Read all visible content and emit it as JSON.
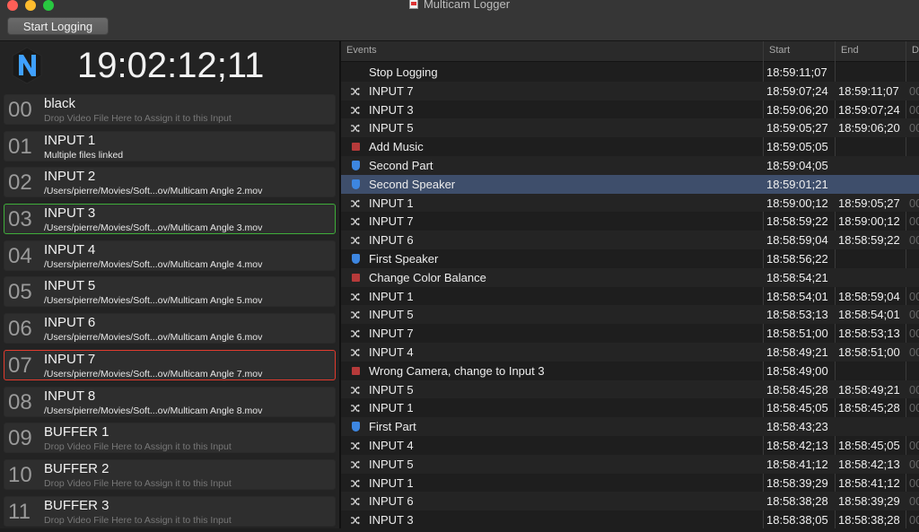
{
  "window": {
    "title": "Multicam Logger"
  },
  "toolbar": {
    "start_label": "Start Logging"
  },
  "timecode": "19:02:12;11",
  "inputs": [
    {
      "num": "00",
      "name": "black",
      "sub": "Drop Video File Here to Assign it to this Input",
      "dim": true,
      "state": ""
    },
    {
      "num": "01",
      "name": "INPUT 1",
      "sub": "Multiple files linked",
      "dim": false,
      "state": ""
    },
    {
      "num": "02",
      "name": "INPUT 2",
      "sub": "/Users/pierre/Movies/Soft...ov/Multicam Angle 2.mov",
      "dim": false,
      "state": ""
    },
    {
      "num": "03",
      "name": "INPUT 3",
      "sub": "/Users/pierre/Movies/Soft...ov/Multicam Angle 3.mov",
      "dim": false,
      "state": "green"
    },
    {
      "num": "04",
      "name": "INPUT 4",
      "sub": "/Users/pierre/Movies/Soft...ov/Multicam Angle 4.mov",
      "dim": false,
      "state": ""
    },
    {
      "num": "05",
      "name": "INPUT 5",
      "sub": "/Users/pierre/Movies/Soft...ov/Multicam Angle 5.mov",
      "dim": false,
      "state": ""
    },
    {
      "num": "06",
      "name": "INPUT 6",
      "sub": "/Users/pierre/Movies/Soft...ov/Multicam Angle 6.mov",
      "dim": false,
      "state": ""
    },
    {
      "num": "07",
      "name": "INPUT 7",
      "sub": "/Users/pierre/Movies/Soft...ov/Multicam Angle 7.mov",
      "dim": false,
      "state": "red"
    },
    {
      "num": "08",
      "name": "INPUT 8",
      "sub": "/Users/pierre/Movies/Soft...ov/Multicam Angle 8.mov",
      "dim": false,
      "state": ""
    },
    {
      "num": "09",
      "name": "BUFFER 1",
      "sub": "Drop Video File Here to Assign it to this Input",
      "dim": true,
      "state": ""
    },
    {
      "num": "10",
      "name": "BUFFER 2",
      "sub": "Drop Video File Here to Assign it to this Input",
      "dim": true,
      "state": ""
    },
    {
      "num": "11",
      "name": "BUFFER 3",
      "sub": "Drop Video File Here to Assign it to this Input",
      "dim": true,
      "state": ""
    }
  ],
  "events": {
    "columns": {
      "events": "Events",
      "start": "Start",
      "end": "End",
      "d": "D"
    },
    "rows": [
      {
        "icon": "none",
        "label": "Stop Logging",
        "start": "18:59:11;07",
        "end": "",
        "extra": ""
      },
      {
        "icon": "shuffle",
        "label": "INPUT 7",
        "start": "18:59:07;24",
        "end": "18:59:11;07",
        "extra": "00"
      },
      {
        "icon": "shuffle",
        "label": "INPUT 3",
        "start": "18:59:06;20",
        "end": "18:59:07;24",
        "extra": "00"
      },
      {
        "icon": "shuffle",
        "label": "INPUT 5",
        "start": "18:59:05;27",
        "end": "18:59:06;20",
        "extra": "00"
      },
      {
        "icon": "stop",
        "label": "Add Music",
        "start": "18:59:05;05",
        "end": "",
        "extra": ""
      },
      {
        "icon": "shield",
        "label": "Second Part",
        "start": "18:59:04;05",
        "end": "",
        "extra": ""
      },
      {
        "icon": "shield",
        "label": "Second Speaker",
        "start": "18:59:01;21",
        "end": "",
        "extra": "",
        "selected": true
      },
      {
        "icon": "shuffle",
        "label": "INPUT 1",
        "start": "18:59:00;12",
        "end": "18:59:05;27",
        "extra": "00"
      },
      {
        "icon": "shuffle",
        "label": "INPUT 7",
        "start": "18:58:59;22",
        "end": "18:59:00;12",
        "extra": "00"
      },
      {
        "icon": "shuffle",
        "label": "INPUT 6",
        "start": "18:58:59;04",
        "end": "18:58:59;22",
        "extra": "00"
      },
      {
        "icon": "shield",
        "label": "First Speaker",
        "start": "18:58:56;22",
        "end": "",
        "extra": ""
      },
      {
        "icon": "stop",
        "label": "Change Color Balance",
        "start": "18:58:54;21",
        "end": "",
        "extra": ""
      },
      {
        "icon": "shuffle",
        "label": "INPUT 1",
        "start": "18:58:54;01",
        "end": "18:58:59;04",
        "extra": "00"
      },
      {
        "icon": "shuffle",
        "label": "INPUT 5",
        "start": "18:58:53;13",
        "end": "18:58:54;01",
        "extra": "00"
      },
      {
        "icon": "shuffle",
        "label": "INPUT 7",
        "start": "18:58:51;00",
        "end": "18:58:53;13",
        "extra": "00"
      },
      {
        "icon": "shuffle",
        "label": "INPUT 4",
        "start": "18:58:49;21",
        "end": "18:58:51;00",
        "extra": "00"
      },
      {
        "icon": "stop",
        "label": "Wrong Camera, change to Input 3",
        "start": "18:58:49;00",
        "end": "",
        "extra": ""
      },
      {
        "icon": "shuffle",
        "label": "INPUT 5",
        "start": "18:58:45;28",
        "end": "18:58:49;21",
        "extra": "00"
      },
      {
        "icon": "shuffle",
        "label": "INPUT 1",
        "start": "18:58:45;05",
        "end": "18:58:45;28",
        "extra": "00"
      },
      {
        "icon": "shield",
        "label": "First Part",
        "start": "18:58:43;23",
        "end": "",
        "extra": ""
      },
      {
        "icon": "shuffle",
        "label": "INPUT 4",
        "start": "18:58:42;13",
        "end": "18:58:45;05",
        "extra": "00"
      },
      {
        "icon": "shuffle",
        "label": "INPUT 5",
        "start": "18:58:41;12",
        "end": "18:58:42;13",
        "extra": "00"
      },
      {
        "icon": "shuffle",
        "label": "INPUT 1",
        "start": "18:58:39;29",
        "end": "18:58:41;12",
        "extra": "00"
      },
      {
        "icon": "shuffle",
        "label": "INPUT 6",
        "start": "18:58:38;28",
        "end": "18:58:39;29",
        "extra": "00"
      },
      {
        "icon": "shuffle",
        "label": "INPUT 3",
        "start": "18:58:38;05",
        "end": "18:58:38;28",
        "extra": "00"
      }
    ]
  }
}
